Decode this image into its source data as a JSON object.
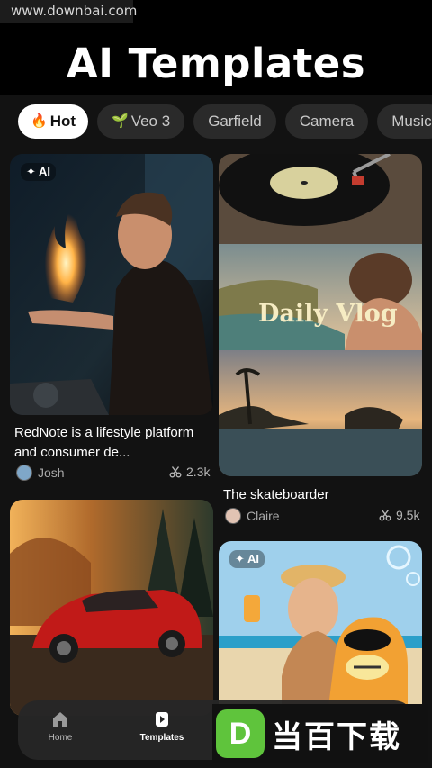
{
  "watermark": {
    "url": "www.downbai.com"
  },
  "header": {
    "title": "AI Templates"
  },
  "tabs": [
    {
      "label": "Hot",
      "icon": "fire-icon",
      "glyph": "🔥",
      "active": true
    },
    {
      "label": "Veo 3",
      "icon": "sprout-icon",
      "glyph": "🌱",
      "active": false
    },
    {
      "label": "Garfield",
      "icon": "",
      "glyph": "",
      "active": false
    },
    {
      "label": "Camera",
      "icon": "",
      "glyph": "",
      "active": false
    },
    {
      "label": "Music",
      "icon": "",
      "glyph": "",
      "active": false
    }
  ],
  "cards": [
    {
      "badge": "✦ AI",
      "title": "RedNote is a lifestyle platform and consumer de...",
      "author": "Josh",
      "count": "2.3k"
    },
    {
      "overlay_text": "Daily Vlog",
      "title": "The skateboarder",
      "author": "Claire",
      "count": "9.5k"
    },
    {
      "badge": "",
      "title": "",
      "author": "",
      "count": ""
    },
    {
      "badge": "✦ AI",
      "title": "",
      "author": "",
      "count": ""
    }
  ],
  "nav": {
    "items": [
      {
        "label": "Home",
        "icon": "home-icon",
        "active": false
      },
      {
        "label": "Templates",
        "icon": "templates-icon",
        "active": true
      }
    ]
  },
  "brand": {
    "logo_letter": "D",
    "text": "当百下载"
  },
  "colors": {
    "background": "#000000",
    "surface": "#121212",
    "chip": "#2a2a2a",
    "brand_green": "#5fc43c"
  }
}
